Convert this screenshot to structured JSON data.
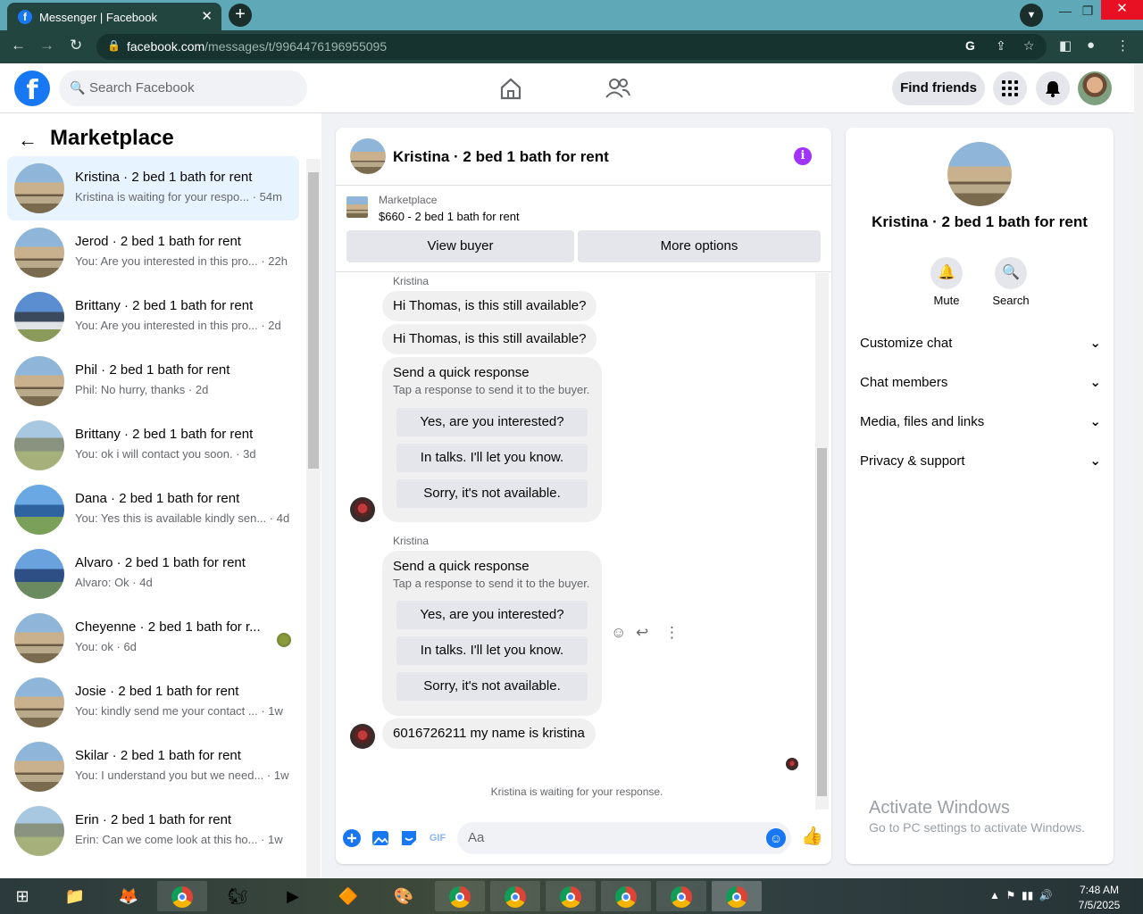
{
  "browser": {
    "tab_title": "Messenger | Facebook",
    "tab_close": "✕",
    "new_tab": "+",
    "url_host": "facebook.com",
    "url_path": "/messages/t/9964476196955095"
  },
  "header": {
    "logo": "f",
    "search_placeholder": "Search Facebook",
    "find_friends": "Find friends"
  },
  "sidebar": {
    "title": "Marketplace",
    "conversations": [
      {
        "name": "Kristina · 2 bed 1 bath for rent",
        "preview": "Kristina is waiting for your respo... · 54m"
      },
      {
        "name": "Jerod · 2 bed 1 bath for rent",
        "preview": "You: Are you interested in this pro... · 22h"
      },
      {
        "name": "Brittany · 2 bed 1 bath for rent",
        "preview": "You: Are you interested in this pro... · 2d"
      },
      {
        "name": "Phil · 2 bed 1 bath for rent",
        "preview": "Phil: No hurry, thanks · 2d"
      },
      {
        "name": "Brittany · 2 bed 1 bath for rent",
        "preview": "You: ok i will contact you soon. · 3d"
      },
      {
        "name": "Dana · 2 bed 1 bath for rent",
        "preview": "You: Yes this is available kindly sen... · 4d"
      },
      {
        "name": "Alvaro · 2 bed 1 bath for rent",
        "preview": "Alvaro: Ok · 4d"
      },
      {
        "name": "Cheyenne · 2 bed 1 bath for r...",
        "preview": "You: ok · 6d"
      },
      {
        "name": "Josie · 2 bed 1 bath for rent",
        "preview": "You: kindly send me your contact ... · 1w"
      },
      {
        "name": "Skilar · 2 bed 1 bath for rent",
        "preview": "You: I understand you but we need... · 1w"
      },
      {
        "name": "Erin · 2 bed 1 bath for rent",
        "preview": "Erin: Can we come look at this ho... · 1w"
      }
    ]
  },
  "chat": {
    "title": "Kristina · 2 bed 1 bath for rent",
    "listing_label": "Marketplace",
    "listing_price": "$660 - 2 bed 1 bath for rent",
    "view_buyer": "View buyer",
    "more_options": "More options",
    "sender": "Kristina",
    "msg1": "Hi Thomas, is this still available?",
    "msg2": "Hi Thomas, is this still available?",
    "quick_title": "Send a quick response",
    "quick_sub": "Tap a response to send it to the buyer.",
    "quick_opts": [
      "Yes, are you interested?",
      "In talks. I'll let you know.",
      "Sorry, it's not available."
    ],
    "msg_last": "6016726211 my name is kristina",
    "waiting": "Kristina is waiting for your response.",
    "composer_placeholder": "Aa"
  },
  "right_panel": {
    "title": "Kristina · 2 bed 1 bath for rent",
    "mute": "Mute",
    "search": "Search",
    "rows": [
      "Customize chat",
      "Chat members",
      "Media, files and links",
      "Privacy & support"
    ],
    "activate_title": "Activate Windows",
    "activate_sub": "Go to PC settings to activate Windows."
  },
  "taskbar": {
    "time": "7:48 AM",
    "date": "7/5/2025"
  }
}
